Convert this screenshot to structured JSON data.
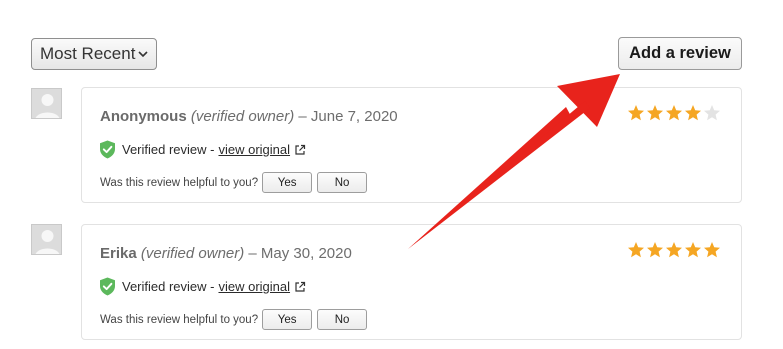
{
  "toolbar": {
    "sort_label": "Most Recent",
    "add_review_label": "Add a review"
  },
  "colors": {
    "star_filled": "#f5a623",
    "star_empty": "#e3e3e3",
    "shield": "#5cb85c",
    "arrow": "#e8231c"
  },
  "reviews": [
    {
      "author": "Anonymous",
      "owner_label": "(verified owner)",
      "date": "– June 7, 2020",
      "rating": 4,
      "verified_text": "Verified review -",
      "view_link": "view original",
      "helpful_prompt": "Was this review helpful to you?",
      "yes_label": "Yes",
      "no_label": "No"
    },
    {
      "author": "Erika",
      "owner_label": "(verified owner)",
      "date": "– May 30, 2020",
      "rating": 5,
      "verified_text": "Verified review -",
      "view_link": "view original",
      "helpful_prompt": "Was this review helpful to you?",
      "yes_label": "Yes",
      "no_label": "No"
    }
  ]
}
